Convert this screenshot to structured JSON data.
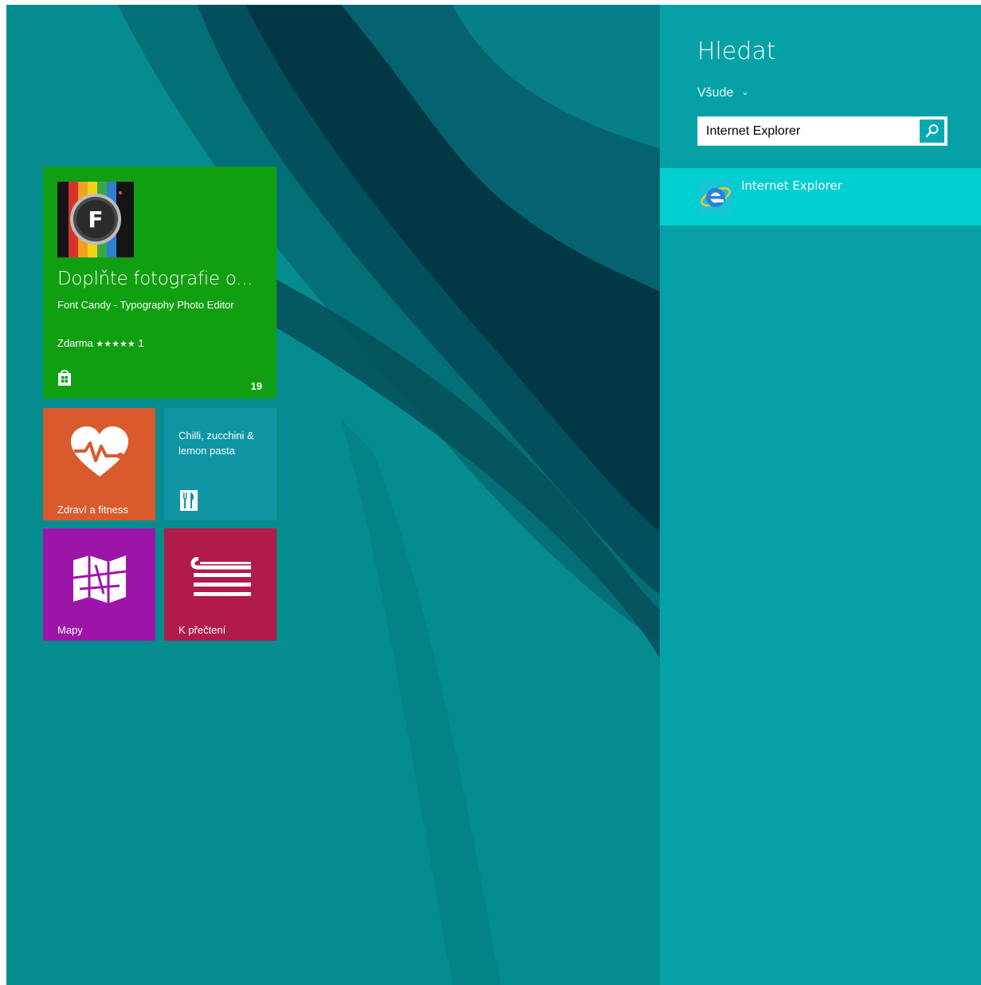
{
  "tiles": {
    "store": {
      "headline": "Doplňte fotografie o...",
      "subtitle": "Font Candy - Typography Photo Editor",
      "price": "Zdarma",
      "stars": "★★★★★",
      "rating_count": "1",
      "badge_count": "19",
      "icon": "store-bag-icon",
      "app_icon": "font-candy-app-icon",
      "app_icon_letter": "F"
    },
    "health": {
      "label": "Zdraví a fitness",
      "icon": "heart-pulse-icon"
    },
    "food": {
      "title": "Chilli, zucchini & lemon pasta",
      "icon": "fork-knife-icon"
    },
    "maps": {
      "label": "Mapy",
      "icon": "map-icon"
    },
    "reading": {
      "label": "K přečtení",
      "icon": "reading-list-icon"
    }
  },
  "search": {
    "title": "Hledat",
    "scope": "Všude",
    "query": "Internet Explorer",
    "button_icon": "search-icon",
    "results": [
      {
        "label": "Internet Explorer",
        "icon": "internet-explorer-icon"
      }
    ]
  },
  "colors": {
    "background": "#058c8e",
    "search_pane": "#05a1a6",
    "result_highlight": "#00cfd1",
    "store_tile": "#119f12",
    "health_tile": "#d95a2c",
    "food_tile": "#0f95a3",
    "maps_tile": "#9d15a8",
    "reading_tile": "#b11b4a"
  }
}
